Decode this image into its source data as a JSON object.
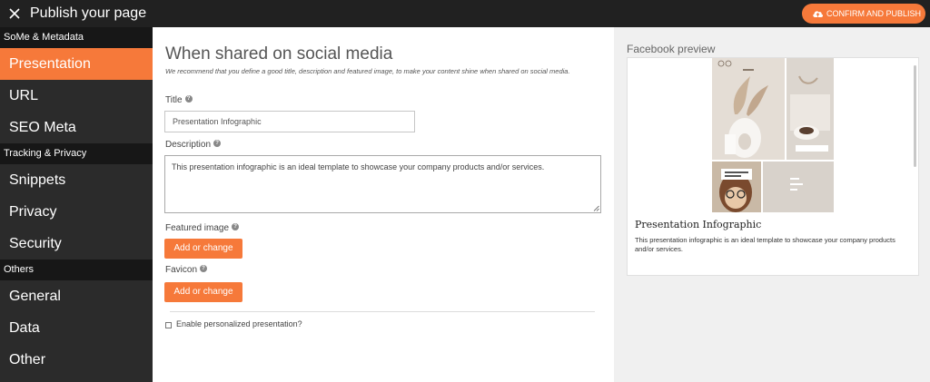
{
  "topbar": {
    "title": "Publish your page",
    "confirm_label": "CONFIRM AND PUBLISH"
  },
  "sidebar": {
    "sections": [
      {
        "label": "SoMe & Metadata",
        "items": [
          {
            "label": "Presentation",
            "active": true
          },
          {
            "label": "URL"
          },
          {
            "label": "SEO Meta"
          }
        ]
      },
      {
        "label": "Tracking & Privacy",
        "items": [
          {
            "label": "Snippets"
          },
          {
            "label": "Privacy"
          },
          {
            "label": "Security"
          }
        ]
      },
      {
        "label": "Others",
        "items": [
          {
            "label": "General"
          },
          {
            "label": "Data"
          },
          {
            "label": "Other"
          }
        ]
      }
    ]
  },
  "main": {
    "heading": "When shared on social media",
    "hint": "We recommend that you define a good title, description and featured image, to make your content shine when shared on social media.",
    "title_label": "Title",
    "title_value": "Presentation Infographic",
    "description_label": "Description",
    "description_value": "This presentation infographic is an ideal template to showcase your company products and/or services.",
    "featured_label": "Featured image",
    "featured_button": "Add or change",
    "favicon_label": "Favicon",
    "favicon_button": "Add or change",
    "personalized_label": "Enable personalized presentation?"
  },
  "preview": {
    "label": "Facebook preview",
    "card_title": "Presentation Infographic",
    "card_description": "This presentation infographic is an ideal template to showcase your company products and/or services."
  },
  "colors": {
    "accent": "#f6793a",
    "topbar": "#212121",
    "sidebar": "#2b2b2b",
    "sidebar_section": "#171717"
  },
  "icons": [
    "close-icon",
    "cloud-upload-icon",
    "help-icon",
    "resize-grip-icon"
  ]
}
